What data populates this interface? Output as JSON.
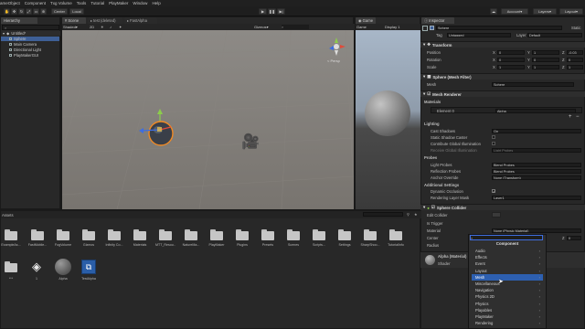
{
  "menubar": [
    "ameObject",
    "Component",
    "Txg Volume",
    "Tools",
    "Tutorial",
    "PlayMaker",
    "Window",
    "Help"
  ],
  "toolbar": {
    "center": "Center",
    "local": "Local",
    "account": "Account",
    "layers": "Layers",
    "layout": "Layout"
  },
  "hierarchy": {
    "tab": "Hierarchy",
    "scene": "Untitled*",
    "items": [
      "Sphere",
      "Main Camera",
      "Directional Light",
      "PlayMakerGUI"
    ]
  },
  "scene_view": {
    "tabs": [
      "Scene",
      "test (deleted)",
      "FastAlpha"
    ],
    "shading": "Shaded",
    "mode": "2D",
    "gizmos": "Gizmos",
    "persp": "< Persp"
  },
  "game_view": {
    "tab": "Game",
    "game": "Game",
    "display": "Display 1"
  },
  "inspector": {
    "tab": "Inspector",
    "object_name": "Sphere",
    "static": "Static",
    "tag_label": "Tag",
    "tag_value": "Untagged",
    "layer_label": "Layer",
    "layer_value": "Default",
    "transform": {
      "title": "Transform",
      "position_label": "Position",
      "rotation_label": "Rotation",
      "scale_label": "Scale",
      "position": [
        "0",
        "1",
        "-0.03"
      ],
      "rotation": [
        "0",
        "0",
        "0"
      ],
      "scale": [
        "1",
        "1",
        "1"
      ],
      "axes": [
        "X",
        "Y",
        "Z"
      ]
    },
    "mesh_filter": {
      "title": "Sphere (Mesh Filter)",
      "mesh_label": "Mesh",
      "mesh_value": "Sphere"
    },
    "mesh_renderer": {
      "title": "Mesh Renderer",
      "materials_label": "Materials",
      "element_label": "Element 0",
      "element_value": "Alpha",
      "lighting_label": "Lighting",
      "cast_shadows_label": "Cast Shadows",
      "cast_shadows_value": "On",
      "static_shadow_label": "Static Shadow Caster",
      "contribute_gi_label": "Contribute Global Illumination",
      "receive_gi_label": "Receive Global Illumination",
      "receive_gi_value": "Light Probes",
      "probes_label": "Probes",
      "light_probes_label": "Light Probes",
      "light_probes_value": "Blend Probes",
      "reflection_probes_label": "Reflection Probes",
      "reflection_probes_value": "Blend Probes",
      "anchor_override_label": "Anchor Override",
      "anchor_override_value": "None (Transform)",
      "additional_label": "Additional Settings",
      "dynamic_occlusion_label": "Dynamic Occlusion",
      "rendering_layer_label": "Rendering Layer Mask",
      "rendering_layer_value": "Layer1"
    },
    "sphere_collider": {
      "title": "Sphere Collider",
      "edit_collider": "Edit Collider",
      "is_trigger": "Is Trigger",
      "material": "Material",
      "center": "Center",
      "radius": "Radius",
      "material_value": "None (Physic Material)",
      "center_z": "0"
    },
    "material_preview": {
      "name": "Alpha (Material)",
      "shader_label": "Shader"
    }
  },
  "component_popup": {
    "search_placeholder": "",
    "title": "Component",
    "items": [
      "Audio",
      "Effects",
      "Event",
      "Layout",
      "Mesh",
      "Miscellaneous",
      "Navigation",
      "Physics 2D",
      "Physics",
      "Playables",
      "PlayMaker",
      "Rendering"
    ],
    "selected": "Mesh"
  },
  "project": {
    "tab": "Assets",
    "folders": [
      "ExampleAs...",
      "FastMobile...",
      "FogVolume",
      "Gizmos",
      "Infinity Co...",
      "Materials",
      "MTT_Resou...",
      "NatureMa...",
      "PlayMaker",
      "Plugins",
      "Presets",
      "Scenes",
      "Scripts...",
      "Settings",
      "SharpShoo...",
      "TutorialInfo"
    ],
    "assets": [
      "***",
      "1",
      "Alpha",
      "TestAlpha"
    ]
  },
  "colors": {
    "accent": "#2d5fb0",
    "selection": "#3e5f96",
    "ground": "#6f6a64",
    "sky": "#a9b7c6"
  }
}
